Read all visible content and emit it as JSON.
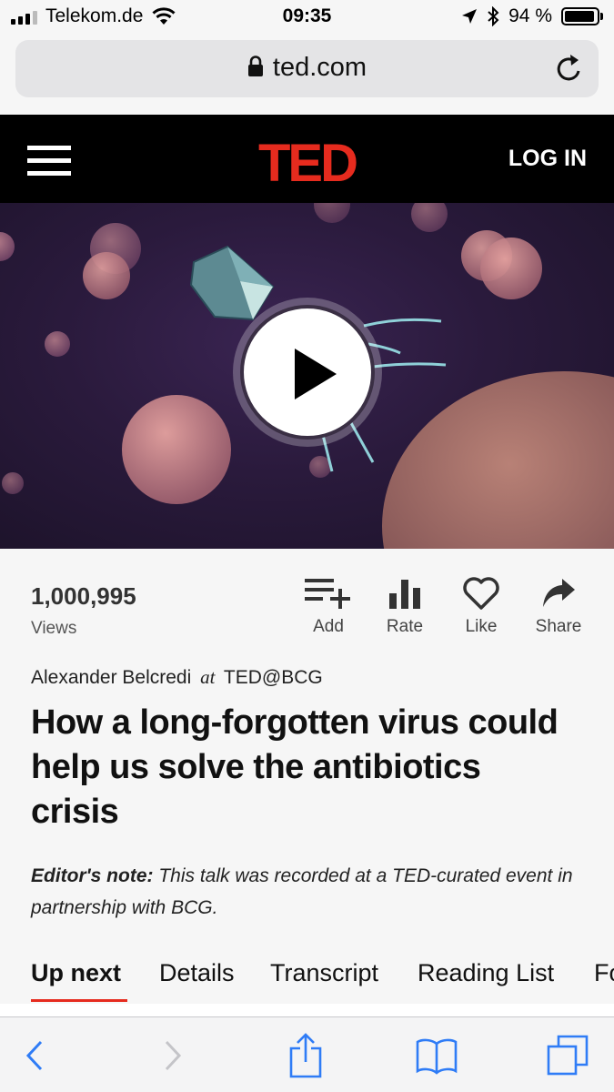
{
  "status_bar": {
    "carrier": "Telekom.de",
    "time": "09:35",
    "battery": "94 %",
    "battery_level": 0.94
  },
  "address_bar": {
    "url": "ted.com"
  },
  "header": {
    "logo": "TED",
    "login_label": "LOG IN",
    "brand_color": "#e62b1e"
  },
  "stats": {
    "views_count": "1,000,995",
    "views_label": "Views"
  },
  "actions": [
    {
      "label": "Add",
      "icon": "add-to-list-icon"
    },
    {
      "label": "Rate",
      "icon": "bar-chart-icon"
    },
    {
      "label": "Like",
      "icon": "heart-icon"
    },
    {
      "label": "Share",
      "icon": "share-arrow-icon"
    }
  ],
  "talk": {
    "speaker": "Alexander Belcredi",
    "at": "at",
    "event": "TED@BCG",
    "title": "How a long-forgotten virus could help us solve the antibiotics crisis",
    "note_label": "Editor's note:",
    "note_text": " This talk was recorded at a TED-curated event in partnership with BCG."
  },
  "tabs": [
    {
      "label": "Up next",
      "active": true
    },
    {
      "label": "Details"
    },
    {
      "label": "Transcript"
    },
    {
      "label": "Reading List"
    },
    {
      "label": "Fo"
    }
  ],
  "toolbar": {
    "icons": [
      "back-icon",
      "forward-icon",
      "share-icon",
      "bookmarks-icon",
      "tabs-icon"
    ]
  }
}
